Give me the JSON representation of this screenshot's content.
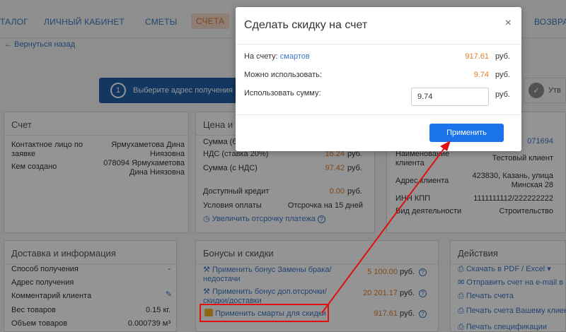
{
  "nav": {
    "items": [
      "ТАЛОГ",
      "ЛИЧНЫЙ КАБИНЕТ",
      "СМЕТЫ",
      "СЧЕТА",
      "ВОЗВРА"
    ],
    "active": "СЧЕТА"
  },
  "back_link": "← Вернуться назад",
  "step": {
    "num": "1",
    "label": "Выберите адрес получения",
    "next_label": "Утв"
  },
  "invoice_panel": {
    "title": "Счет",
    "rows": [
      {
        "label": "Контактное лицо по заявке",
        "value": "Ярмухаметова Дина Ниязовна"
      },
      {
        "label": "Кем создано",
        "value": "078094 Ярмухаметова Дина Ниязовна"
      }
    ]
  },
  "price_panel": {
    "title": "Цена и у",
    "rows": [
      {
        "label": "Сумма (бе",
        "value": ""
      },
      {
        "label": "НДС (ставка 20%)",
        "value": "16.24",
        "unit": "руб."
      },
      {
        "label": "Сумма (с НДС)",
        "value": "97.42",
        "unit": "руб."
      },
      {
        "label": "Доступный кредит",
        "value": "0.00",
        "unit": "руб."
      },
      {
        "label": "Условия оплаты",
        "value": "Отсрочка на 15 дней"
      }
    ],
    "extend_link": "Увеличить отсрочку платежа"
  },
  "client_panel": {
    "rows": [
      {
        "label": "",
        "value": "071694"
      },
      {
        "label": "Наименование клиента",
        "value": "Тестовый клиент"
      },
      {
        "label": "Адрес клиента",
        "value": "423830, Казань, улица Минская 28"
      },
      {
        "label": "ИНН КПП",
        "value": "1111111112/222222222"
      },
      {
        "label": "Вид деятельности",
        "value": "Строительство"
      }
    ]
  },
  "delivery_panel": {
    "title": "Доставка и информация",
    "rows": [
      {
        "label": "Способ получения",
        "value": "-"
      },
      {
        "label": "Адрес получения",
        "value": ""
      },
      {
        "label": "Комментарий клиента",
        "value": ""
      },
      {
        "label": "Вес товаров",
        "value": "0.15 кг."
      },
      {
        "label": "Объем товаров",
        "value": "0.000739 м³"
      }
    ]
  },
  "bonus_panel": {
    "title": "Бонусы и скидки",
    "items": [
      {
        "label": "Применить бонус Замены брака/недостачи",
        "value": "5 100.00",
        "unit": "руб."
      },
      {
        "label": "Применить бонус доп.отсрочки/скидки/доставки",
        "value": "20 201.17",
        "unit": "руб."
      },
      {
        "label": "Применить смарты для скидки",
        "value": "917.61",
        "unit": "руб."
      }
    ]
  },
  "actions_panel": {
    "title": "Действия",
    "items": [
      "Скачать в PDF / Excel ▾",
      "Отправить счет на e-mail в",
      "Печать счета",
      "Печать счета Вашему клиент",
      "Печать спецификации"
    ]
  },
  "modal": {
    "title": "Сделать скидку на счет",
    "close": "×",
    "on_account_label": "На счету:",
    "on_account_link": "смартов",
    "on_account_value": "917.61",
    "can_use_label": "Можно использовать:",
    "can_use_value": "9.74",
    "use_sum_label": "Использовать сумму:",
    "use_sum_input": "9.74",
    "unit": "руб.",
    "apply_button": "Применить"
  }
}
